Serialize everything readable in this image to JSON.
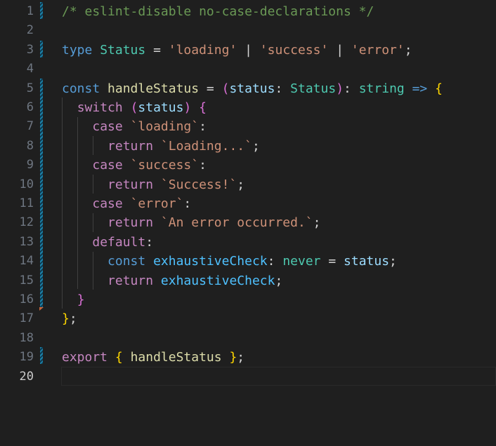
{
  "editor": {
    "language": "typescript",
    "active_line": 20,
    "lines": [
      {
        "n": "1",
        "text": "/* eslint-disable no-case-declarations */"
      },
      {
        "n": "2",
        "text": ""
      },
      {
        "n": "3",
        "text": "type Status = 'loading' | 'success' | 'error';"
      },
      {
        "n": "4",
        "text": ""
      },
      {
        "n": "5",
        "text": "const handleStatus = (status: Status): string => {"
      },
      {
        "n": "6",
        "text": "  switch (status) {"
      },
      {
        "n": "7",
        "text": "    case `loading`:"
      },
      {
        "n": "8",
        "text": "      return `Loading...`;"
      },
      {
        "n": "9",
        "text": "    case `success`:"
      },
      {
        "n": "10",
        "text": "      return `Success!`;"
      },
      {
        "n": "11",
        "text": "    case `error`:"
      },
      {
        "n": "12",
        "text": "      return `An error occurred.`;"
      },
      {
        "n": "13",
        "text": "    default:"
      },
      {
        "n": "14",
        "text": "      const exhaustiveCheck: never = status;"
      },
      {
        "n": "15",
        "text": "      return exhaustiveCheck;"
      },
      {
        "n": "16",
        "text": "  }"
      },
      {
        "n": "17",
        "text": "};"
      },
      {
        "n": "18",
        "text": ""
      },
      {
        "n": "19",
        "text": "export { handleStatus };"
      },
      {
        "n": "20",
        "text": ""
      }
    ]
  },
  "colors": {
    "background": "#1f1f1f",
    "line_number": "#6e7681",
    "active_line_number": "#cccccc",
    "comment": "#6a9955",
    "keyword": "#569cd6",
    "control": "#c586c0",
    "type": "#4ec9b0",
    "string": "#ce9178",
    "function": "#dcdcaa",
    "variable": "#9cdcfe",
    "constant": "#4fc1ff",
    "git_modified": "#1b81a8",
    "git_deleted": "#c5653a"
  }
}
